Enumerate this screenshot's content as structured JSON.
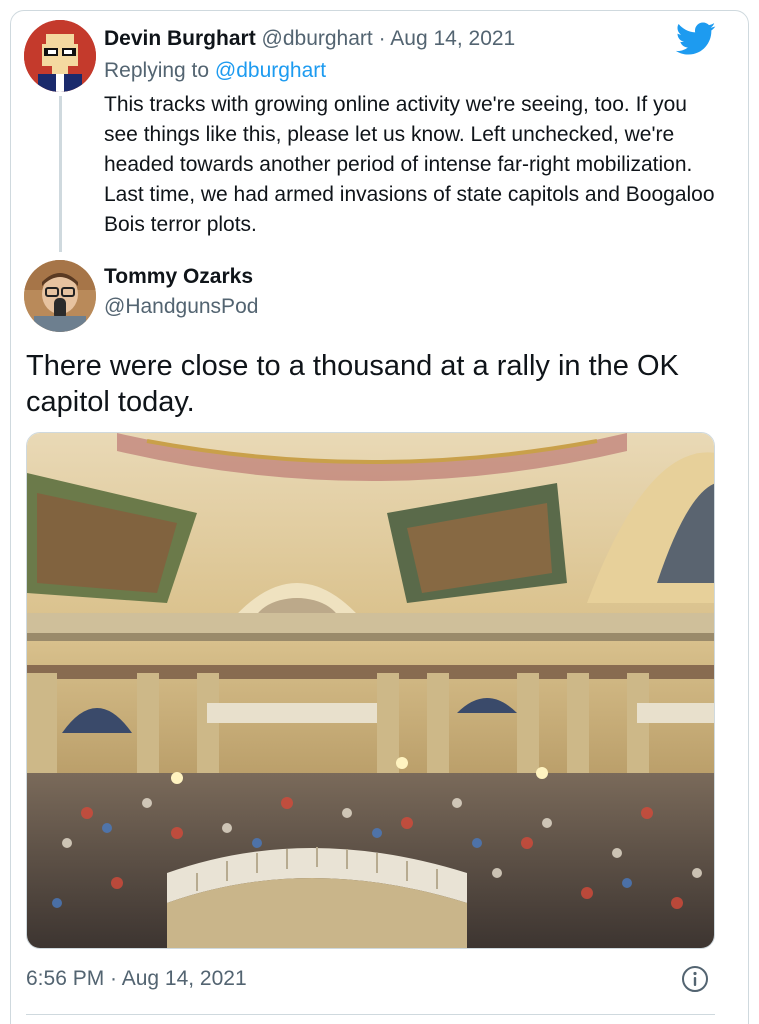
{
  "reply": {
    "author_name": "Devin Burghart",
    "author_handle": "@dburghart",
    "separator": "·",
    "date": "Aug 14, 2021",
    "replying_label": "Replying to",
    "replying_handle": "@dburghart",
    "text": "This tracks with growing online activity we're seeing, too. If you see things like this, please let us know. Left unchecked, we're headed towards another period of intense far-right mobilization. Last time, we had armed invasions of state capitols and Boogaloo Bois terror plots."
  },
  "tweet": {
    "author_name": "Tommy Ozarks",
    "author_handle": "@HandgunsPod",
    "text": "There were close to a thousand at a rally in the OK capitol today.",
    "timestamp": "6:56 PM · Aug 14, 2021"
  },
  "icons": {
    "brand": "twitter-bird-icon",
    "info": "info-icon"
  },
  "colors": {
    "brand_blue": "#1d9bf0",
    "secondary_text": "#536471",
    "border": "#cfd9de"
  }
}
